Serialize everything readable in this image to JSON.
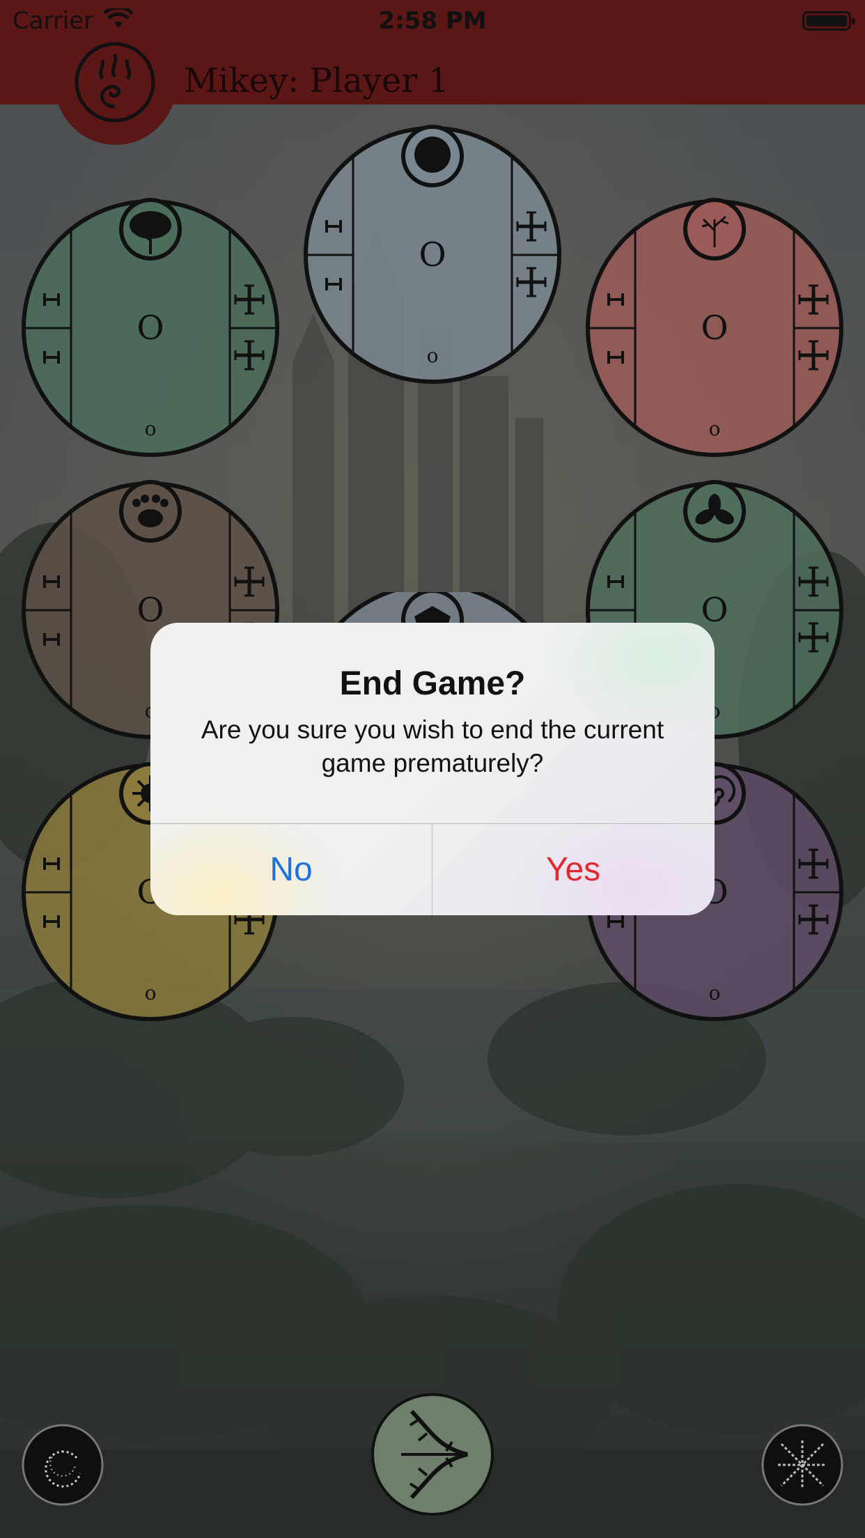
{
  "status_bar": {
    "carrier": "Carrier",
    "time": "2:58 PM"
  },
  "header": {
    "player_name": "Mikey: Player 1",
    "player_icon": "fire-spiral-icon"
  },
  "boards": [
    {
      "id": "forest",
      "icon": "tree-icon",
      "color": "#4b6d5a",
      "center": "O",
      "bottom": "o"
    },
    {
      "id": "moon",
      "icon": "moon-icon",
      "color": "#7b8790",
      "center": "O",
      "bottom": "o"
    },
    {
      "id": "dead-tree",
      "icon": "dead-tree-icon",
      "color": "#9a5a57",
      "center": "O",
      "bottom": "o"
    },
    {
      "id": "bear",
      "icon": "paw-icon",
      "color": "#5d5148",
      "center": "O",
      "bottom": "o"
    },
    {
      "id": "leaves",
      "icon": "trefoil-icon",
      "color": "#4f6e5b",
      "center": "O",
      "bottom": "o"
    },
    {
      "id": "sun",
      "icon": "sunburst-icon",
      "color": "#8b7a3c",
      "center": "O",
      "bottom": "o"
    },
    {
      "id": "spiral",
      "icon": "spiral-icon",
      "color": "#5e4e66",
      "center": "O",
      "bottom": "o"
    }
  ],
  "bottom_buttons": {
    "left": "vine-circle-icon",
    "center": "thorn-arrow-icon",
    "right": "thorn-star-icon"
  },
  "alert": {
    "title": "End Game?",
    "message": "Are you sure you wish to end the current game prematurely?",
    "no_label": "No",
    "yes_label": "Yes",
    "no_color": "#1f6fe0",
    "yes_color": "#e5272f"
  }
}
